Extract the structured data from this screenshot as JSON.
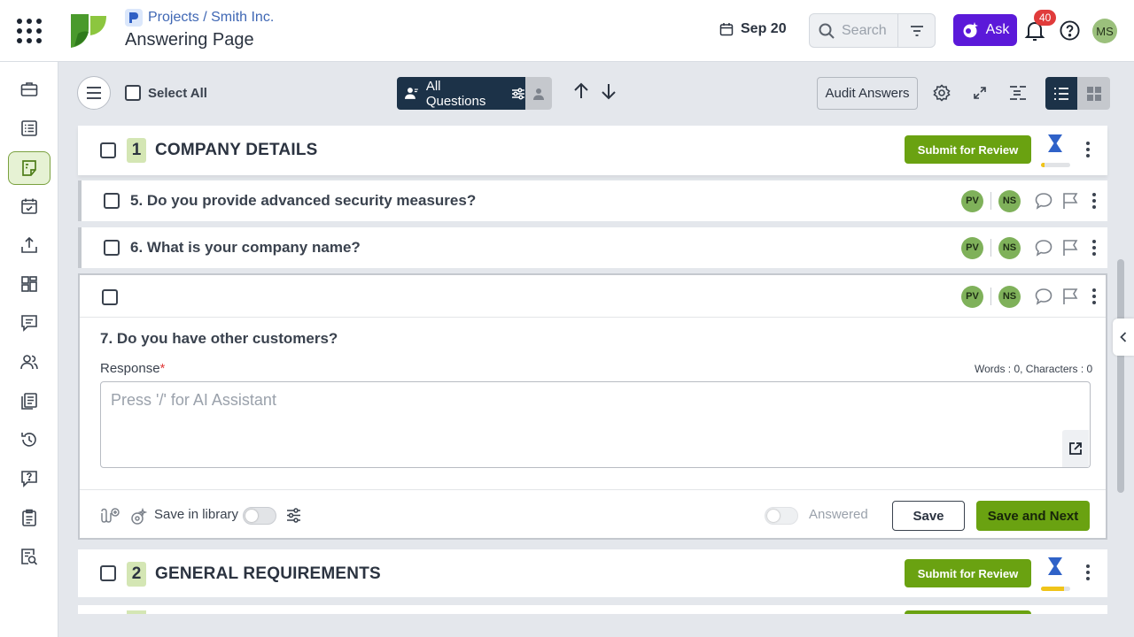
{
  "header": {
    "breadcrumb": "Projects / Smith Inc.",
    "title": "Answering Page",
    "date": "Sep 20",
    "search_placeholder": "Search",
    "ask_label": "Ask",
    "notification_count": "40",
    "user_initials": "MS"
  },
  "sidebar": {
    "items": [
      {
        "icon": "briefcase-icon"
      },
      {
        "icon": "list-icon"
      },
      {
        "icon": "answering-icon",
        "active": true
      },
      {
        "icon": "calendar-check-icon"
      },
      {
        "icon": "upload-icon"
      },
      {
        "icon": "dashboard-icon"
      },
      {
        "icon": "chat-icon"
      },
      {
        "icon": "users-icon"
      },
      {
        "icon": "documents-icon"
      },
      {
        "icon": "history-icon"
      },
      {
        "icon": "question-chat-icon"
      },
      {
        "icon": "clipboard-icon"
      },
      {
        "icon": "search-doc-icon"
      }
    ]
  },
  "toolbar": {
    "select_all": "Select All",
    "filter_label": "All Questions",
    "audit_label": "Audit Answers"
  },
  "sections": [
    {
      "number": "1",
      "title": "COMPANY DETAILS",
      "submit_label": "Submit for Review",
      "progress": 0.12
    },
    {
      "number": "2",
      "title": "GENERAL REQUIREMENTS",
      "submit_label": "Submit for Review",
      "progress": 0.8
    }
  ],
  "questions": [
    {
      "title": "5. Do you provide advanced security measures?",
      "assignees": [
        "PV",
        "NS"
      ]
    },
    {
      "title": "6. What is your company name?",
      "assignees": [
        "PV",
        "NS"
      ]
    }
  ],
  "active_question": {
    "assignees": [
      "PV",
      "NS"
    ],
    "title": "7. Do you have other customers?",
    "response_label": "Response",
    "required_mark": "*",
    "counter": "Words : 0, Characters : 0",
    "placeholder": "Press '/' for AI Assistant",
    "save_in_library": "Save in library",
    "answered_label": "Answered",
    "save_label": "Save",
    "save_next_label": "Save and Next"
  },
  "colors": {
    "accent_green": "#6aa211",
    "navy": "#1c3248",
    "ask_purple": "#5b19d9",
    "badge_red": "#e03b3b"
  }
}
